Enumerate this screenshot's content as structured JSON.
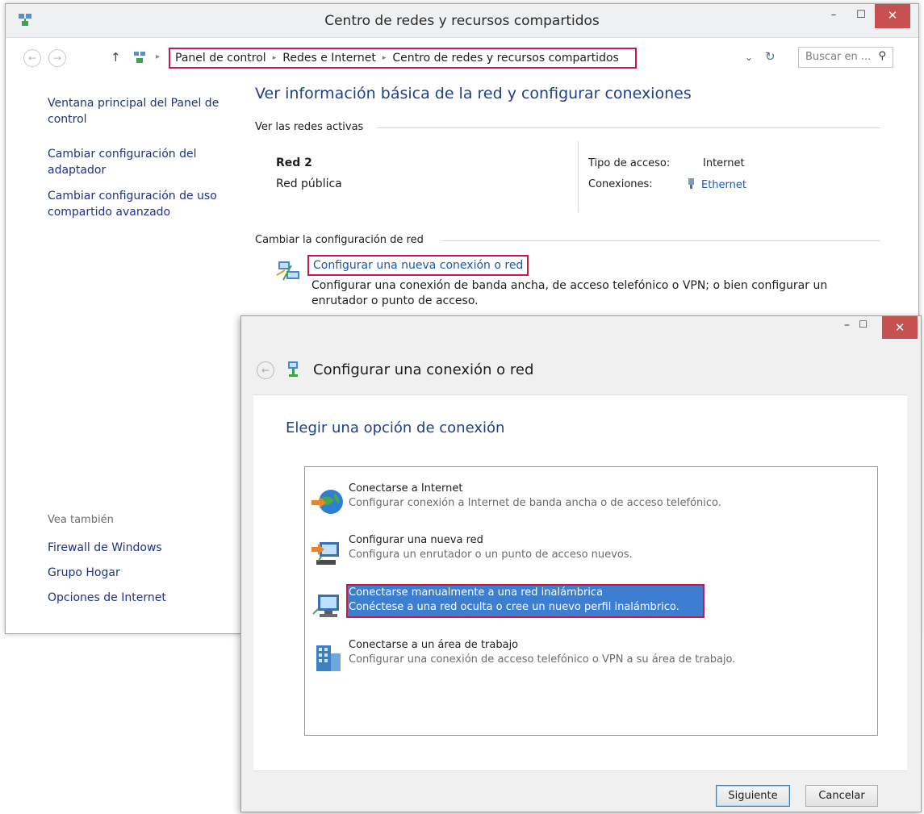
{
  "main_window": {
    "title": "Centro de redes y recursos compartidos",
    "controls": {
      "minimize": "–",
      "maximize": "☐",
      "close": "✕"
    },
    "nav": {
      "back": "←",
      "forward": "→",
      "up": "↑",
      "breadcrumb": [
        "Panel de control",
        "Redes e Internet",
        "Centro de redes y recursos compartidos"
      ],
      "search_placeholder": "Buscar en ...",
      "dropdown": "⌄",
      "refresh": "↻",
      "search_glyph": "⚲"
    },
    "sidebar": {
      "links": [
        "Ventana principal del Panel de control",
        "Cambiar configuración del adaptador",
        "Cambiar configuración de uso compartido avanzado"
      ],
      "see_also_label": "Vea también",
      "see_also": [
        "Firewall de Windows",
        "Grupo Hogar",
        "Opciones de Internet"
      ]
    },
    "content": {
      "heading": "Ver información básica de la red y configurar conexiones",
      "active_networks_label": "Ver las redes activas",
      "network_name": "Red 2",
      "network_type": "Red pública",
      "access_type_label": "Tipo de acceso:",
      "access_type_value": "Internet",
      "connections_label": "Conexiones:",
      "connections_value": "Ethernet",
      "change_settings_label": "Cambiar la configuración de red",
      "new_connection_link": "Configurar una nueva conexión o red",
      "new_connection_desc": "Configurar una conexión de banda ancha, de acceso telefónico o VPN; o bien configurar un enrutador o punto de acceso."
    }
  },
  "dialog": {
    "controls": {
      "minimize": "–",
      "maximize": "☐",
      "close": "✕"
    },
    "back": "←",
    "title": "Configurar una conexión o red",
    "heading": "Elegir una opción de conexión",
    "options": [
      {
        "title": "Conectarse a Internet",
        "desc": "Configurar conexión a Internet de banda ancha o de acceso telefónico.",
        "icon": "globe-icon"
      },
      {
        "title": "Configurar una nueva red",
        "desc": "Configura un enrutador o un punto de acceso nuevos.",
        "icon": "router-icon"
      },
      {
        "title": "Conectarse manualmente a una red inalámbrica",
        "desc": "Conéctese a una red oculta o cree un nuevo perfil inalámbrico.",
        "icon": "wireless-computer-icon",
        "selected": true
      },
      {
        "title": "Conectarse a un área de trabajo",
        "desc": "Configurar una conexión de acceso telefónico o VPN a su área de trabajo.",
        "icon": "workplace-icon"
      }
    ],
    "next_button": "Siguiente",
    "cancel_button": "Cancelar"
  },
  "colors": {
    "link": "#1e3287",
    "heading": "#1e3f8b",
    "highlight_border": "#c8194b",
    "selection": "#3d7ed1",
    "close_button": "#c75050"
  }
}
